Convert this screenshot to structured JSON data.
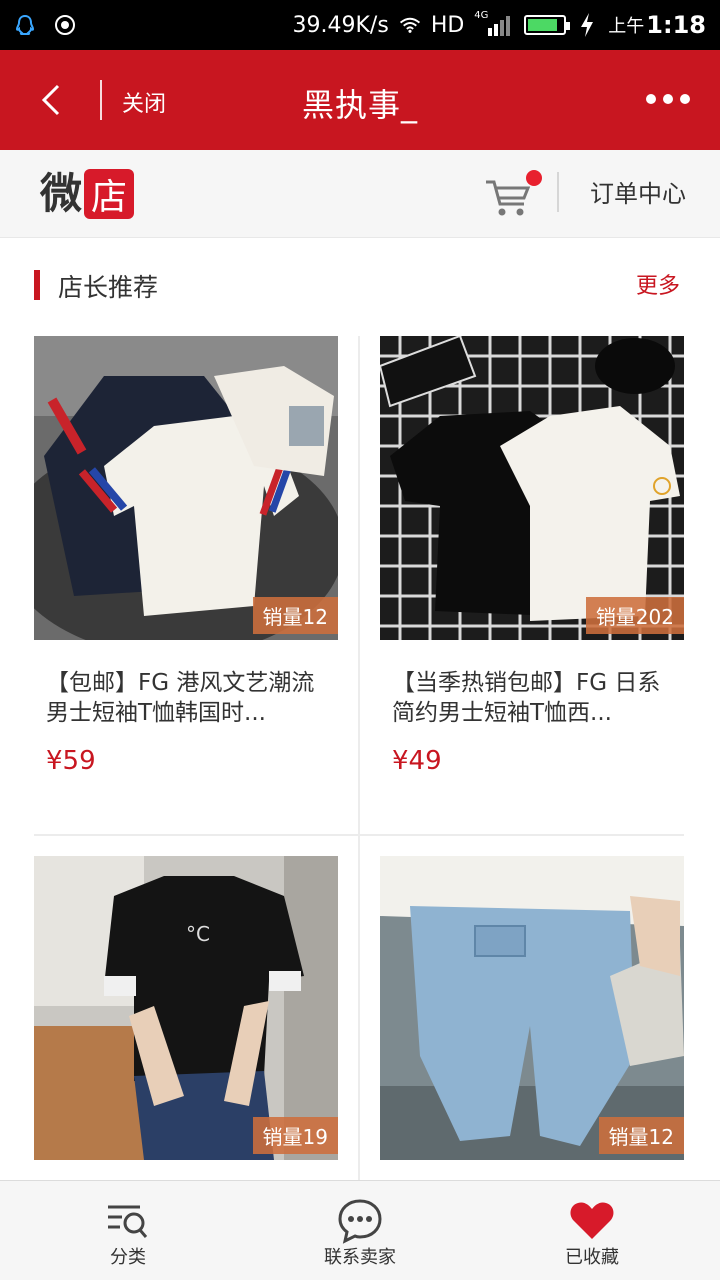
{
  "status_bar": {
    "network_speed": "39.49K/s",
    "hd_label": "HD",
    "signal_type": "4G",
    "battery_level": 0.85,
    "ampm": "上午",
    "time": "1:18"
  },
  "header": {
    "close_label": "关闭",
    "title": "黑执事_"
  },
  "shop": {
    "logo_part1": "微",
    "logo_part2": "店",
    "orders_label": "订单中心"
  },
  "section": {
    "title": "店长推荐",
    "more_label": "更多"
  },
  "products": [
    {
      "sales": "销量12",
      "title": "【包邮】FG 港风文艺潮流男士短袖T恤韩国时...",
      "price": "¥59"
    },
    {
      "sales": "销量202",
      "title": "【当季热销包邮】FG 日系简约男士短袖T恤西...",
      "price": "¥49"
    },
    {
      "sales": "销量19",
      "title": "",
      "price": ""
    },
    {
      "sales": "销量12",
      "title": "",
      "price": ""
    }
  ],
  "nav": {
    "category_label": "分类",
    "contact_label": "联系卖家",
    "favorited_label": "已收藏"
  },
  "colors": {
    "brand_red": "#c81620",
    "accent_orange": "#cd6e3c"
  }
}
